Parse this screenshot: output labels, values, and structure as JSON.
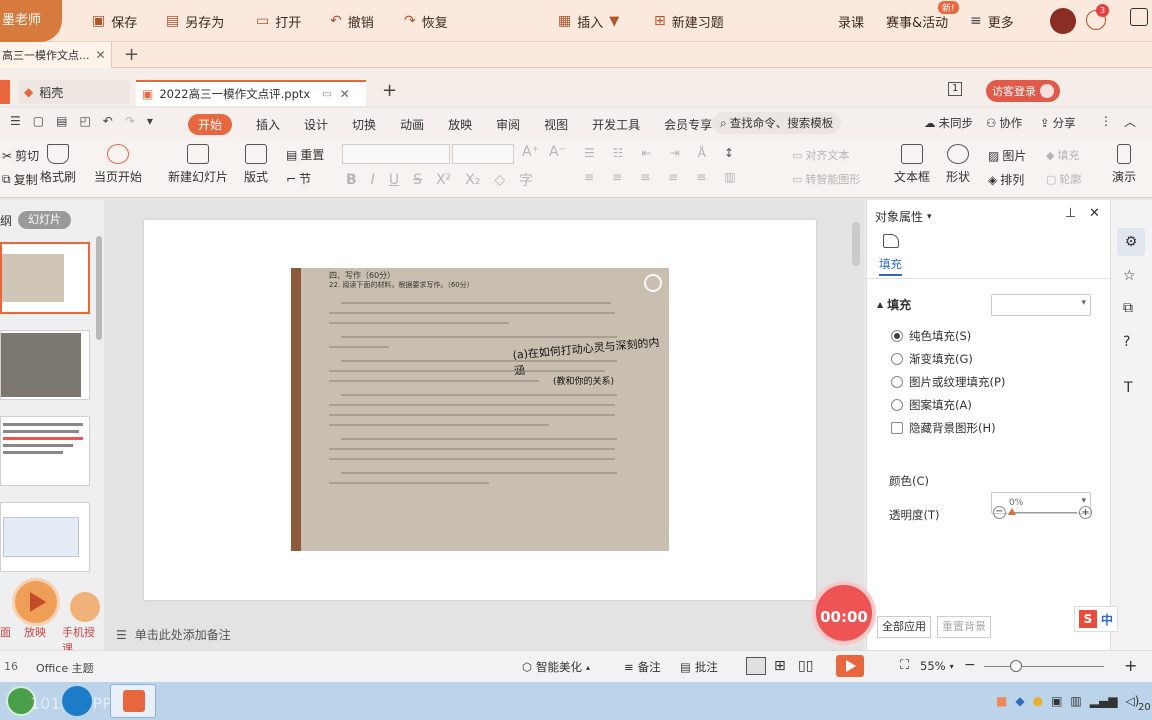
{
  "topbar": {
    "brand": "墨老师",
    "save": "保存",
    "save_as": "另存为",
    "open": "打开",
    "undo": "撤销",
    "redo": "恢复",
    "insert": "插入",
    "new_exercise": "新建习题",
    "record": "录课",
    "events": "赛事&活动",
    "events_badge": "新!",
    "more": "更多",
    "notif_badge": "3"
  },
  "tabbar1": {
    "tab_label": "高三一模作文点..."
  },
  "tabbar2": {
    "draft_tab": "稻壳",
    "file_tab": "2022高三一模作文点评.pptx",
    "page_indicator": "1",
    "login": "访客登录"
  },
  "menubar": {
    "items": [
      "开始",
      "插入",
      "设计",
      "切换",
      "动画",
      "放映",
      "审阅",
      "视图",
      "开发工具",
      "会员专享"
    ],
    "search": "查找命令、搜索模板",
    "not_synced": "未同步",
    "collab": "协作",
    "share": "分享"
  },
  "ribbon": {
    "cut": "剪切",
    "copy": "复制",
    "format_painter": "格式刷",
    "from_current": "当页开始",
    "new_slide": "新建幻灯片",
    "layout": "版式",
    "section": "节",
    "reset": "重置",
    "textbox": "文本框",
    "shape": "形状",
    "arrange": "排列",
    "picture": "图片",
    "fill": "填充",
    "outline": "轮廓",
    "present": "演示",
    "align_text": "对齐文本",
    "convert_smartart": "转智能图形"
  },
  "leftpane": {
    "tab_outline": "纲",
    "tab_slides": "幻灯片",
    "play_label": "放映",
    "mobile_label": "手机授课",
    "left_label": "面"
  },
  "notes_placeholder": "单击此处添加备注",
  "rightpanel": {
    "title": "对象属性",
    "fill_tab": "填充",
    "fill_section": "填充",
    "options": [
      "纯色填充(S)",
      "渐变填充(G)",
      "图片或纹理填充(P)",
      "图案填充(A)"
    ],
    "selected_option": 0,
    "hide_bg": "隐藏背景图形(H)",
    "color_label": "颜色(C)",
    "transparency_label": "透明度(T)",
    "transparency_value": "0%",
    "apply_all": "全部应用",
    "reset_bg": "重置背景"
  },
  "timer": "00:00",
  "ime": "中",
  "statusbar": {
    "slide_no": "16",
    "theme": "Office 主题",
    "smart_beautify": "智能美化",
    "notes": "备注",
    "comments": "批注",
    "zoom": "55%"
  },
  "taskbar": {
    "watermark": "101教育PPT",
    "clock": "20"
  },
  "paper": {
    "heading": "四、写作（60分）",
    "question": "22. 阅读下面的材料，根据要求写作。（60分）",
    "handwriting1": "(a)在如何打动心灵与深刻的内涵",
    "handwriting2": "(教和你的关系)"
  }
}
